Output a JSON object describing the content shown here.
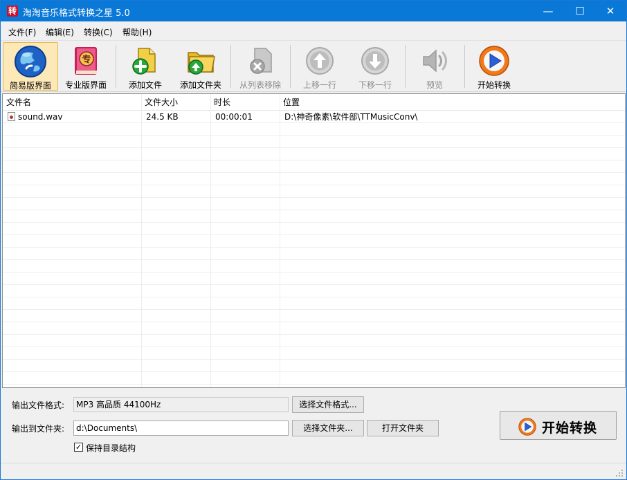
{
  "window": {
    "title": "淘淘音乐格式转换之星 5.0",
    "app_icon_text": "转",
    "controls": {
      "minimize": "—",
      "maximize": "☐",
      "close": "✕"
    }
  },
  "menu": [
    {
      "label": "文件(F)"
    },
    {
      "label": "编辑(E)"
    },
    {
      "label": "转换(C)"
    },
    {
      "label": "帮助(H)"
    }
  ],
  "toolbar": [
    {
      "label": "简易版界面",
      "icon": "globe-icon",
      "state": "active"
    },
    {
      "label": "专业版界面",
      "icon": "book-icon",
      "state": "normal"
    },
    {
      "label": "添加文件",
      "icon": "add-file-icon",
      "state": "normal"
    },
    {
      "label": "添加文件夹",
      "icon": "add-folder-icon",
      "state": "normal"
    },
    {
      "label": "从列表移除",
      "icon": "remove-icon",
      "state": "disabled"
    },
    {
      "label": "上移一行",
      "icon": "arrow-up-icon",
      "state": "disabled"
    },
    {
      "label": "下移一行",
      "icon": "arrow-down-icon",
      "state": "disabled"
    },
    {
      "label": "预览",
      "icon": "speaker-icon",
      "state": "disabled"
    },
    {
      "label": "开始转换",
      "icon": "play-icon",
      "state": "normal"
    }
  ],
  "file_list": {
    "columns": [
      "文件名",
      "文件大小",
      "时长",
      "位置"
    ],
    "rows": [
      {
        "name": "sound.wav",
        "size": "24.5 KB",
        "duration": "00:00:01",
        "location": "D:\\神奇像素\\软件部\\TTMusicConv\\"
      }
    ]
  },
  "output": {
    "format_label": "输出文件格式:",
    "format_value": "MP3 高品质 44100Hz",
    "choose_format_button": "选择文件格式...",
    "folder_label": "输出到文件夹:",
    "folder_value": "d:\\Documents\\",
    "choose_folder_button": "选择文件夹...",
    "open_folder_button": "打开文件夹",
    "keep_structure_label": "保持目录结构",
    "keep_structure_checked": true,
    "checkmark": "✓",
    "start_button": "开始转换"
  },
  "colors": {
    "titlebar": "#0a78d7",
    "active_tool": "#fde9b8",
    "accent_orange": "#f07a1a",
    "accent_blue": "#2c5fd6"
  }
}
